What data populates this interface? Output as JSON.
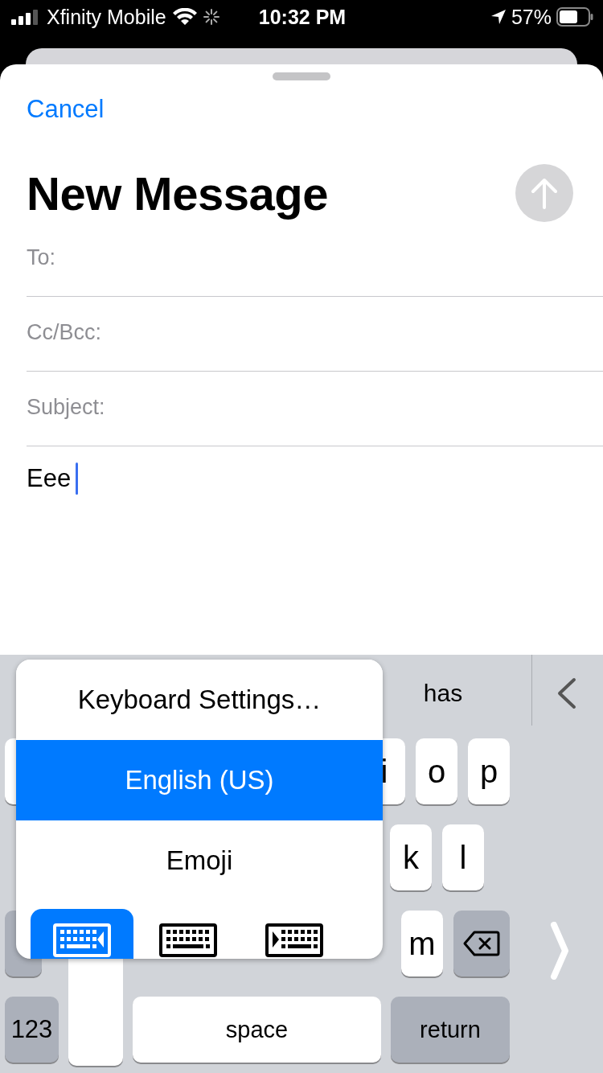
{
  "status_bar": {
    "carrier": "Xfinity Mobile",
    "time": "10:32 PM",
    "battery": "57%"
  },
  "compose": {
    "cancel": "Cancel",
    "title": "New Message",
    "fields": [
      {
        "label": "To:"
      },
      {
        "label": "Cc/Bcc:"
      },
      {
        "label": "Subject:"
      }
    ],
    "body": "Eee"
  },
  "keyboard": {
    "suggestions": [
      "has"
    ],
    "rows": [
      [
        {
          "kind": "stub"
        },
        {
          "kind": "spacer"
        },
        {
          "kind": "letter",
          "label": "i"
        },
        {
          "kind": "letter",
          "label": "o"
        },
        {
          "kind": "letter",
          "label": "p"
        }
      ],
      [
        {
          "kind": "spacer"
        },
        {
          "kind": "letter",
          "label": "k"
        },
        {
          "kind": "letter",
          "label": "l"
        }
      ],
      [
        {
          "kind": "shiftstub"
        },
        {
          "kind": "spacer"
        },
        {
          "kind": "letter",
          "label": "m"
        },
        {
          "kind": "delete"
        }
      ],
      [
        {
          "kind": "function",
          "label": "123"
        },
        {
          "kind": "pressed"
        },
        {
          "kind": "space",
          "label": "space"
        },
        {
          "kind": "return",
          "label": "return"
        }
      ]
    ]
  },
  "menu": {
    "items": [
      {
        "label": "Keyboard Settings…",
        "selected": false
      },
      {
        "label": "English (US)",
        "selected": true
      },
      {
        "label": "Emoji",
        "selected": false
      }
    ],
    "modes": [
      {
        "kind": "left",
        "selected": true
      },
      {
        "kind": "full",
        "selected": false
      },
      {
        "kind": "right",
        "selected": false
      }
    ]
  }
}
